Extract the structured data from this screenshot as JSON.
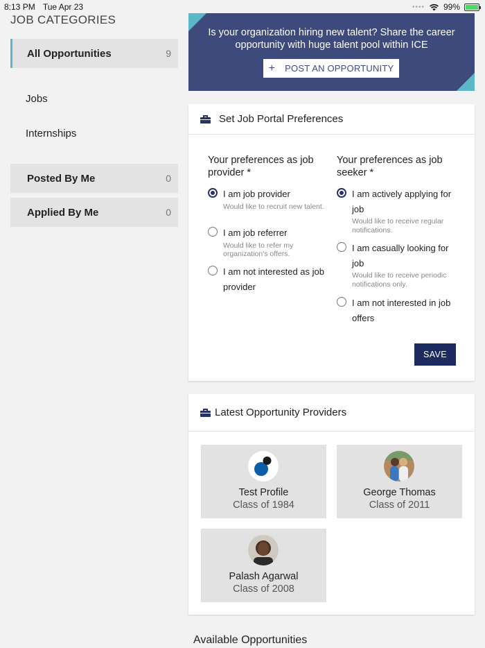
{
  "status_bar": {
    "time": "8:13 PM",
    "date": "Tue Apr 23",
    "battery": "99%",
    "battery_level": 0.99
  },
  "sidebar": {
    "title": "JOB CATEGORIES",
    "all_opportunities": {
      "label": "All Opportunities",
      "count": "9"
    },
    "jobs_label": "Jobs",
    "internships_label": "Internships",
    "posted_by_me": {
      "label": "Posted By Me",
      "count": "0"
    },
    "applied_by_me": {
      "label": "Applied By Me",
      "count": "0"
    }
  },
  "banner": {
    "text": "Is your organization hiring new talent? Share the career opportunity with huge talent pool within ICE",
    "button_icon": "+",
    "button_label": "POST AN OPPORTUNITY",
    "bg_color": "#3e4a7c",
    "accent_color": "#5bb8c9"
  },
  "preferences": {
    "title": "Set Job Portal Preferences",
    "icon": "briefcase-icon",
    "provider": {
      "heading": "Your preferences as job provider *",
      "options": [
        {
          "label": "I am job provider",
          "sub": "Would like to recruit new talent.",
          "checked": true
        },
        {
          "label": "I am job referrer",
          "sub": "Would like to refer my organization's offers.",
          "checked": false
        },
        {
          "label": "I am not interested as job provider",
          "sub": "",
          "checked": false
        }
      ]
    },
    "seeker": {
      "heading": "Your preferences as job seeker *",
      "options": [
        {
          "label": "I am actively applying for job",
          "sub": "Would like to receive regular notifications.",
          "checked": true
        },
        {
          "label": "I am casually looking for job",
          "sub": "Would like to receive periodic notifications only.",
          "checked": false
        },
        {
          "label": "I am not interested in job offers",
          "sub": "",
          "checked": false
        }
      ]
    },
    "save_label": "SAVE",
    "primary_color": "#1d2a5f"
  },
  "providers": {
    "title": "Latest Opportunity Providers",
    "icon": "briefcase-icon",
    "items": [
      {
        "name": "Test Profile",
        "class": "Class of 1984",
        "avatar": "logo-avatar"
      },
      {
        "name": "George Thomas",
        "class": "Class of 2011",
        "avatar": "photo-avatar"
      },
      {
        "name": "Palash Agarwal",
        "class": "Class of 2008",
        "avatar": "photo-avatar"
      }
    ]
  },
  "available_title": "Available Opportunities"
}
